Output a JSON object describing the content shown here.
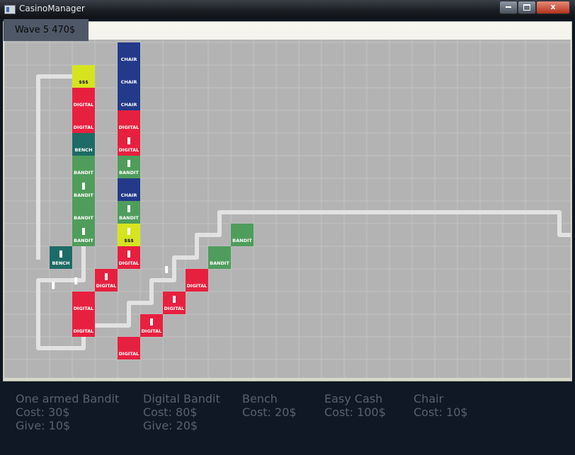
{
  "window": {
    "title": "CasinoManager",
    "close_glyph": "x"
  },
  "status": {
    "wave_text": "Wave 5 470$"
  },
  "colors": {
    "board_bg": "#b3b3b3",
    "grid_line": "#c3c3c3",
    "path": "#e2e2e2",
    "chair": "#233a8a",
    "digital": "#e8203f",
    "bandit": "#4f9d5c",
    "bench": "#1d6b66",
    "easy_cash": "#d6e41e"
  },
  "legend": [
    {
      "name": "One armed Bandit",
      "cost": "Cost: 30$",
      "give": "Give: 10$"
    },
    {
      "name": "Digital Bandit",
      "cost": "Cost: 80$",
      "give": "Give: 20$"
    },
    {
      "name": "Bench",
      "cost": "Cost: 20$",
      "give": ""
    },
    {
      "name": "Easy Cash",
      "cost": "Cost: 100$",
      "give": ""
    },
    {
      "name": "Chair",
      "cost": "Cost: 10$",
      "give": ""
    }
  ],
  "labels": {
    "chair": "CHAIR",
    "digital": "DIGITAL",
    "bandit": "BANDIT",
    "bench": "BENCH",
    "easy_cash": "$$$"
  },
  "grid": {
    "cols": 25,
    "rows": 15
  },
  "path": [
    [
      1,
      9
    ],
    [
      1,
      1
    ],
    [
      3,
      1
    ],
    [
      3,
      10
    ],
    [
      1,
      10
    ],
    [
      1,
      13
    ],
    [
      3,
      13
    ],
    [
      3,
      12
    ],
    [
      4,
      12
    ],
    [
      4,
      11
    ],
    [
      5,
      11
    ],
    [
      5,
      10
    ],
    [
      6,
      10
    ],
    [
      6,
      9
    ],
    [
      7,
      9
    ],
    [
      7,
      8
    ],
    [
      8,
      8
    ],
    [
      8,
      7
    ],
    [
      23,
      7
    ],
    [
      23,
      8
    ],
    [
      25,
      8
    ]
  ],
  "tiles": [
    {
      "type": "easy_cash",
      "col": 2,
      "row": 1,
      "marker": false
    },
    {
      "type": "digital",
      "col": 2,
      "row": 2,
      "marker": false
    },
    {
      "type": "digital",
      "col": 2,
      "row": 3,
      "marker": false
    },
    {
      "type": "bench",
      "col": 2,
      "row": 4,
      "marker": false
    },
    {
      "type": "bandit",
      "col": 2,
      "row": 5,
      "marker": false
    },
    {
      "type": "bandit",
      "col": 2,
      "row": 6,
      "marker": true
    },
    {
      "type": "bandit",
      "col": 2,
      "row": 7,
      "marker": false
    },
    {
      "type": "bandit",
      "col": 2,
      "row": 8,
      "marker": true
    },
    {
      "type": "bench",
      "col": 1,
      "row": 9,
      "marker": true
    },
    {
      "type": "digital",
      "col": 3,
      "row": 10,
      "marker": true
    },
    {
      "type": "digital",
      "col": 2,
      "row": 11,
      "marker": false
    },
    {
      "type": "digital",
      "col": 2,
      "row": 12,
      "marker": false
    },
    {
      "type": "chair",
      "col": 4,
      "row": 0,
      "marker": false
    },
    {
      "type": "chair",
      "col": 4,
      "row": 1,
      "marker": false
    },
    {
      "type": "chair",
      "col": 4,
      "row": 2,
      "marker": false
    },
    {
      "type": "digital",
      "col": 4,
      "row": 3,
      "marker": false
    },
    {
      "type": "digital",
      "col": 4,
      "row": 4,
      "marker": true
    },
    {
      "type": "bandit",
      "col": 4,
      "row": 5,
      "marker": true
    },
    {
      "type": "chair",
      "col": 4,
      "row": 6,
      "marker": false
    },
    {
      "type": "bandit",
      "col": 4,
      "row": 7,
      "marker": true
    },
    {
      "type": "easy_cash",
      "col": 4,
      "row": 8,
      "marker": true
    },
    {
      "type": "digital",
      "col": 4,
      "row": 9,
      "marker": true
    },
    {
      "type": "digital",
      "col": 4,
      "row": 13,
      "marker": false
    },
    {
      "type": "digital",
      "col": 5,
      "row": 12,
      "marker": true
    },
    {
      "type": "digital",
      "col": 6,
      "row": 11,
      "marker": true
    },
    {
      "type": "digital",
      "col": 7,
      "row": 10,
      "marker": false
    },
    {
      "type": "bandit",
      "col": 8,
      "row": 9,
      "marker": false
    },
    {
      "type": "bandit",
      "col": 9,
      "row": 8,
      "marker": false
    }
  ],
  "agents": [
    [
      1.6,
      10.7
    ],
    [
      2.6,
      10.5
    ],
    [
      6.6,
      10.0
    ],
    [
      24.7,
      8.2
    ]
  ]
}
